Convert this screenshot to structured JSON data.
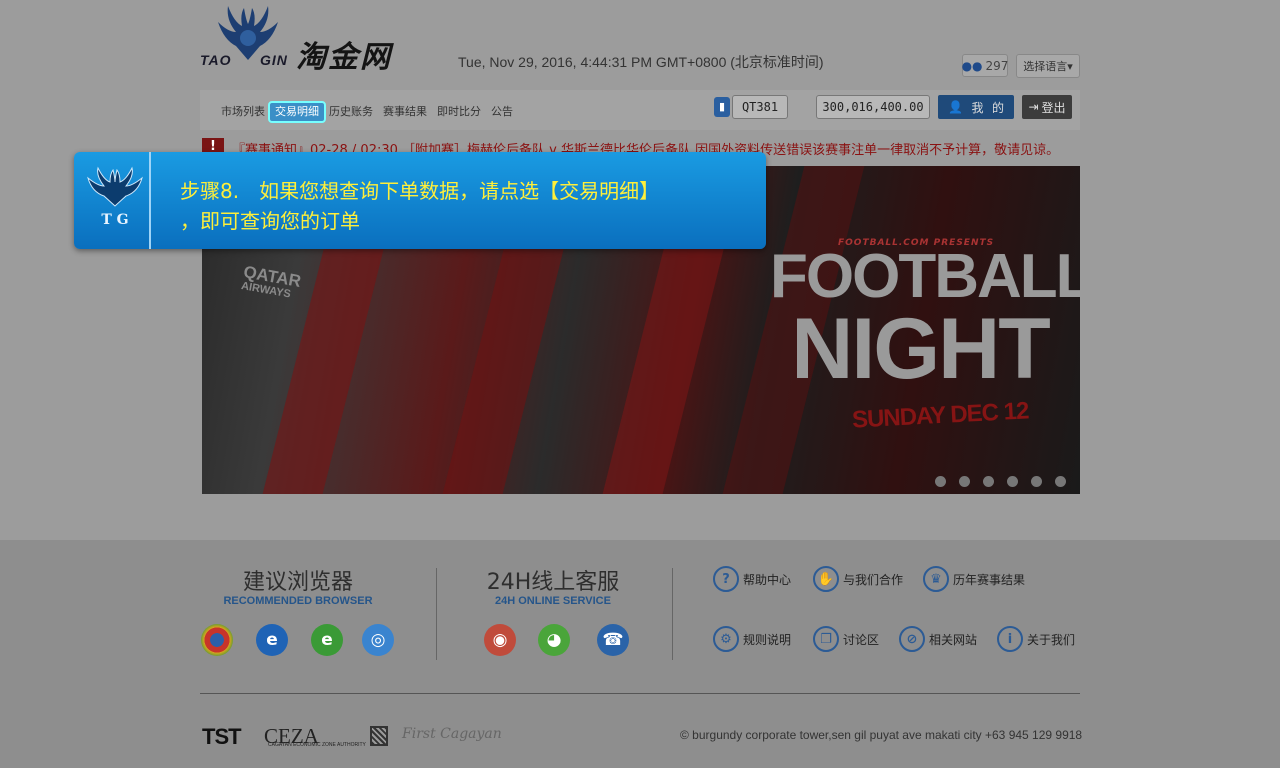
{
  "header": {
    "logo_left": "TAO",
    "logo_right": "GIN",
    "logo_cn": "淘金网",
    "datetime": "Tue, Nov 29, 2016, 4:44:31 PM GMT+0800 (北京标准时间)",
    "online_count": "297",
    "language_label": "选择语言▾"
  },
  "nav": {
    "items": [
      "市场列表",
      "交易明细",
      "历史账务",
      "赛事结果",
      "即时比分",
      "公告"
    ],
    "active_index": 1
  },
  "account": {
    "username": "QT381",
    "balance": "300,016,400.00",
    "my_label": "我",
    "my_label_2": "的",
    "logout_label": "登出"
  },
  "ticker": {
    "icon": "!",
    "text": "『赛事通知』02-28 / 02:30 ［附加赛］梅赫伦后备队 v 华斯兰德比华伦后备队 因国外资料传送错误该赛事注单一律取消不予计算，敬请见谅。"
  },
  "banner": {
    "sponsor_main": "QATAR",
    "sponsor_sub": "AIRWAYS",
    "presents": "FOOTBALL.COM PRESENTS",
    "title_1": "FOOTBALL",
    "title_2": "NIGHT",
    "date": "SUNDAY DEC 12",
    "slide_count": 6
  },
  "callout": {
    "text_line1": "步骤8.　如果您想查询下单数据，请点选【交易明细】",
    "text_line2": "，即可查询您的订单"
  },
  "footer": {
    "browser_title": "建议浏览器",
    "browser_sub": "RECOMMENDED BROWSER",
    "service_title": "24H线上客服",
    "service_sub": "24H ONLINE SERVICE",
    "links": [
      "帮助中心",
      "与我们合作",
      "历年赛事结果",
      "规则说明",
      "讨论区",
      "相关网站",
      "关于我们"
    ],
    "partner_tst": "TST",
    "partner_ceza": "CEZA",
    "partner_ceza_sub": "CAGAYAN ECONOMIC ZONE AUTHORITY",
    "partner_first": "First Cagayan",
    "copyright": "© burgundy corporate tower,sen gil puyat ave makati city +63 945 129 9918"
  },
  "colors": {
    "callout_bg": "#1a9be2",
    "callout_text": "#ffef3a",
    "active_tab": "#3b8fc7",
    "ticker_text": "#8a1212"
  }
}
